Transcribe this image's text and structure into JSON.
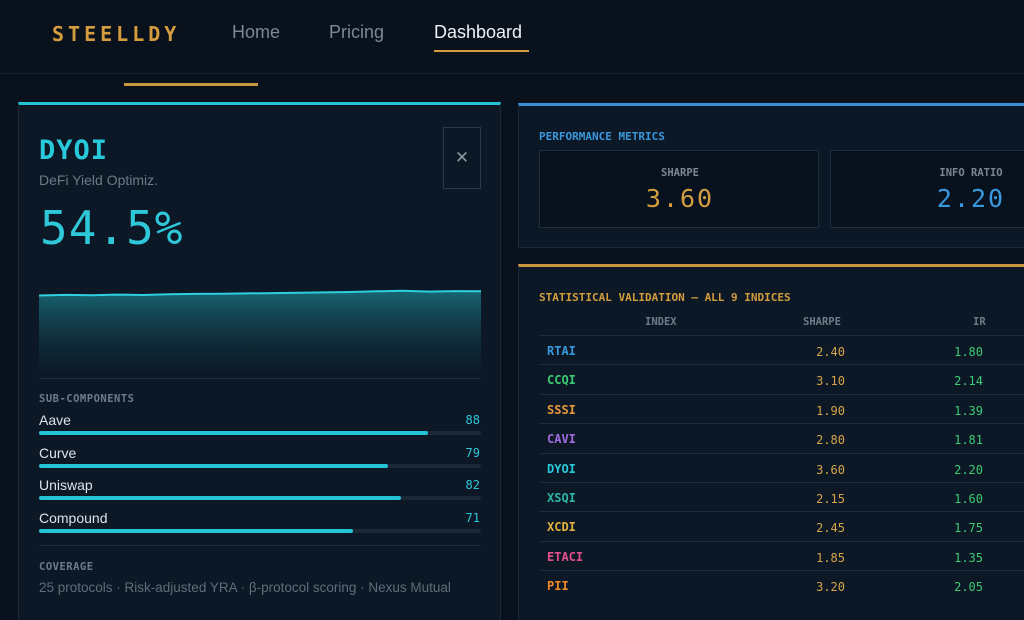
{
  "brand": "STEELLDY",
  "nav": {
    "home": "Home",
    "pricing": "Pricing",
    "dashboard": "Dashboard",
    "active": "Dashboard"
  },
  "index_card": {
    "ticker": "DYOI",
    "name": "DeFi Yield Optimiz.",
    "value": "54.5%",
    "close_icon": "close-icon",
    "sparkline": [
      0.275,
      0.27,
      0.273,
      0.268,
      0.271,
      0.265,
      0.262,
      0.26,
      0.258,
      0.255,
      0.252,
      0.249,
      0.246,
      0.24,
      0.236,
      0.242,
      0.238,
      0.24
    ],
    "sub_components_label": "SUB-COMPONENTS",
    "components": [
      {
        "name": "Aave",
        "value": "88",
        "fill": 0.88
      },
      {
        "name": "Curve",
        "value": "79",
        "fill": 0.79
      },
      {
        "name": "Uniswap",
        "value": "82",
        "fill": 0.82
      },
      {
        "name": "Compound",
        "value": "71",
        "fill": 0.71
      }
    ],
    "coverage_label": "COVERAGE",
    "coverage_text": "25 protocols · Risk-adjusted YRA · β-protocol scoring · Nexus Mutual"
  },
  "performance": {
    "title": "PERFORMANCE METRICS",
    "metrics": [
      {
        "label": "SHARPE",
        "value": "3.60",
        "color": "#d39d3e"
      },
      {
        "label": "INFO RATIO",
        "value": "2.20",
        "color": "#3a98dc"
      }
    ]
  },
  "validation": {
    "title": "STATISTICAL VALIDATION — ALL 9 INDICES",
    "headers": {
      "index": "INDEX",
      "sharpe": "SHARPE",
      "ir": "IR"
    },
    "rows": [
      {
        "index": "RTAI",
        "sharpe": "2.40",
        "ir": "1.80",
        "color": "#3a98dc"
      },
      {
        "index": "CCQI",
        "sharpe": "3.10",
        "ir": "2.14",
        "color": "#3ccb74"
      },
      {
        "index": "SSSI",
        "sharpe": "1.90",
        "ir": "1.39",
        "color": "#e8973a"
      },
      {
        "index": "CAVI",
        "sharpe": "2.80",
        "ir": "1.81",
        "color": "#a06ce0"
      },
      {
        "index": "DYOI",
        "sharpe": "3.60",
        "ir": "2.20",
        "color": "#28c9db"
      },
      {
        "index": "XSQI",
        "sharpe": "2.15",
        "ir": "1.60",
        "color": "#2bb5a6"
      },
      {
        "index": "XCDI",
        "sharpe": "2.45",
        "ir": "1.75",
        "color": "#e3b23c"
      },
      {
        "index": "ETACI",
        "sharpe": "1.85",
        "ir": "1.35",
        "color": "#e0508a"
      },
      {
        "index": "PII",
        "sharpe": "3.20",
        "ir": "2.05",
        "color": "#f08a28"
      }
    ]
  }
}
